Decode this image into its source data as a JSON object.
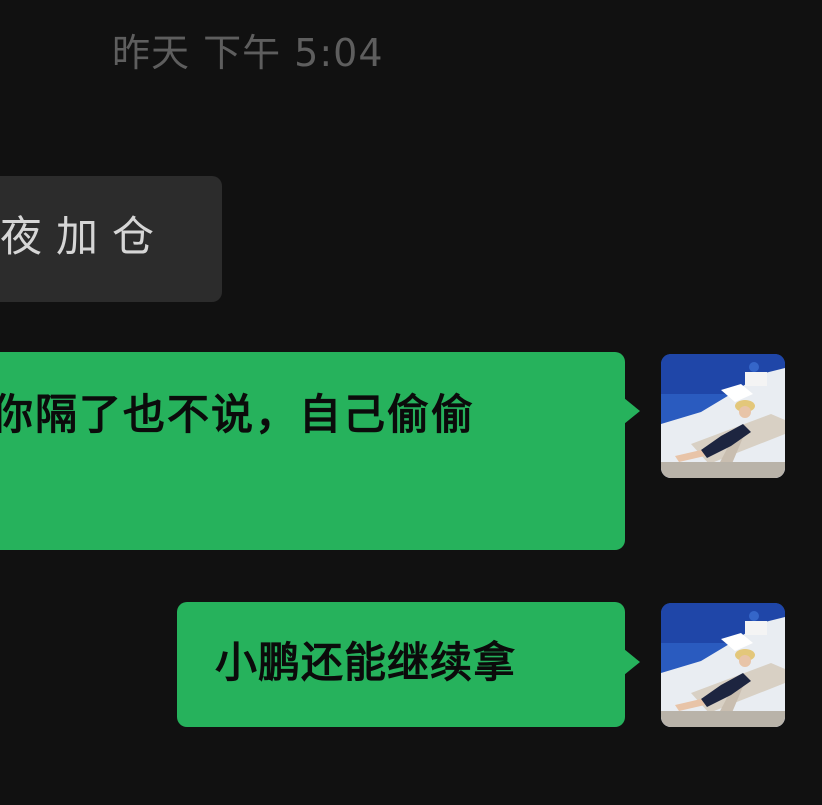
{
  "chat": {
    "timestamp": "昨天 下午 5:04",
    "messages": [
      {
        "direction": "incoming",
        "text": "夜加仓"
      },
      {
        "direction": "outgoing",
        "text": "你隔了也不说，自己偷偷"
      },
      {
        "direction": "outgoing",
        "text": "小鹏还能继续拿"
      }
    ]
  },
  "colors": {
    "background": "#111111",
    "incoming_bubble": "#2c2c2c",
    "outgoing_bubble": "#26b25c",
    "timestamp_text": "#5e5e5e"
  },
  "icons": {
    "avatar": "user-avatar-photo"
  }
}
